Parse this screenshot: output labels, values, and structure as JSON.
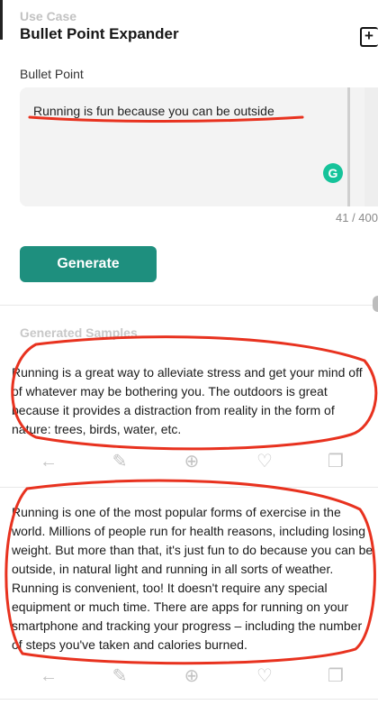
{
  "header": {
    "section_label": "Use Case",
    "title": "Bullet Point Expander"
  },
  "bullet_point": {
    "label": "Bullet Point",
    "value": "Running is fun because you can be outside",
    "char_count": "41 / 400"
  },
  "generate_button": {
    "label": "Generate"
  },
  "generated": {
    "label": "Generated Samples",
    "samples": [
      {
        "text": "Running is a great way to alleviate stress and get your mind off of whatever may be bothering you. The outdoors is great because it provides a distraction from reality in the form of nature: trees, birds, water, etc."
      },
      {
        "text": "Running is one of the most popular forms of exercise in the world. Millions of people run for health reasons, including losing weight. But more than that, it's just fun to do because you can be outside, in natural light and running in all sorts of weather. Running is convenient, too! It doesn't require any special equipment or much time. There are apps for running on your smartphone and tracking your progress – including the number of steps you've taken and calories burned."
      }
    ]
  },
  "icons": {
    "back": "arrow-left-icon",
    "edit": "edit-icon",
    "add": "plus-circle-icon",
    "like": "heart-icon",
    "copy": "copy-icon"
  },
  "colors": {
    "accent": "#1e8f7e",
    "annotation": "#e8321f",
    "muted": "#c4c4c4"
  }
}
